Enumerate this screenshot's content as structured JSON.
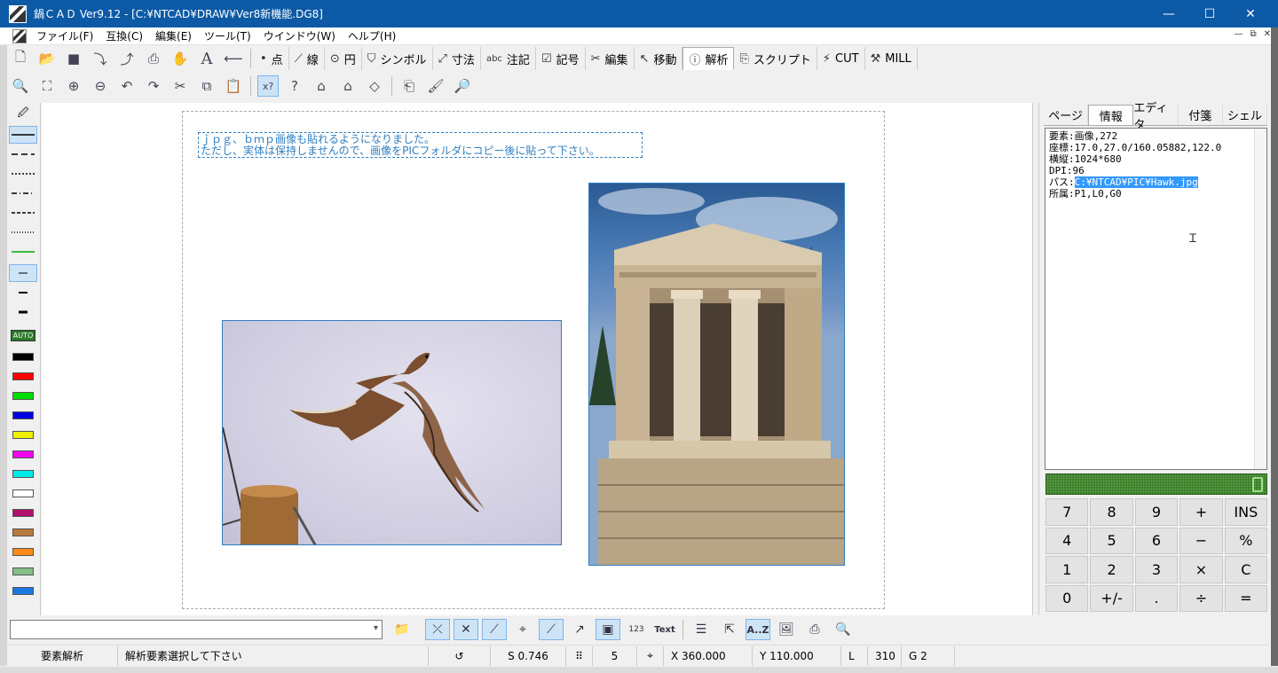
{
  "window": {
    "title": "鍋ＣＡＤ Ver9.12 - [C:¥NTCAD¥DRAW¥Ver8新機能.DG8]",
    "minimize": "—",
    "maximize": "☐",
    "close": "✕"
  },
  "menu": {
    "items": [
      "ファイル(F)",
      "互換(C)",
      "編集(E)",
      "ツール(T)",
      "ウインドウ(W)",
      "ヘルプ(H)"
    ],
    "mdi_buttons": [
      "—",
      "⧉",
      "✕"
    ]
  },
  "tabs": [
    {
      "label": "点",
      "icon": "point-icon"
    },
    {
      "label": "線",
      "icon": "line-icon"
    },
    {
      "label": "円",
      "icon": "circle-icon"
    },
    {
      "label": "シンボル",
      "icon": "symbol-icon"
    },
    {
      "label": "寸法",
      "icon": "dimension-icon"
    },
    {
      "label": "注記",
      "icon": "annotation-icon",
      "prefix": "abc"
    },
    {
      "label": "記号",
      "icon": "mark-icon"
    },
    {
      "label": "編集",
      "icon": "edit-icon"
    },
    {
      "label": "移動",
      "icon": "move-icon"
    },
    {
      "label": "解析",
      "icon": "info-icon",
      "active": true
    },
    {
      "label": "スクリプト",
      "icon": "script-icon"
    },
    {
      "label": "CUT",
      "icon": "cut-tool-icon"
    },
    {
      "label": "MILL",
      "icon": "mill-icon"
    }
  ],
  "canvas": {
    "note_line1": "ｊｐｇ、ｂｍｐ画像も貼れるようになりました。",
    "note_line2": "ただし、実体は保持しませんので、画像をPICフォルダにコピー後に貼って下さい。",
    "palette_auto": "AUTO",
    "palette_colors": [
      "#000000",
      "#ff0000",
      "#00e000",
      "#0000e0",
      "#f0f000",
      "#f000f0",
      "#00e8e8",
      "#ffffff",
      "#b0106a",
      "#b87a3a",
      "#ff8a1a",
      "#84c086",
      "#1a78e0"
    ],
    "line_color": "#2f7fc1"
  },
  "right_panel": {
    "tabs": [
      "ページ",
      "情報",
      "エディタ",
      "付箋",
      "シェル"
    ],
    "active_tab": "情報",
    "info": {
      "line1": "要素:画像,272",
      "line2": "座標:17.0,27.0/160.05882,122.0",
      "line3": "横縦:1024*680",
      "line4": "DPI:96",
      "line5_label": "パス:",
      "line5_value": "C:¥NTCAD¥PIC¥Hawk.jpg",
      "line6": "所属:P1,L0,G0"
    },
    "calculator": {
      "keys": [
        "7",
        "8",
        "9",
        "+",
        "INS",
        "4",
        "5",
        "6",
        "−",
        "%",
        "1",
        "2",
        "3",
        "×",
        "C",
        "0",
        "+/-",
        ".",
        "÷",
        "="
      ]
    }
  },
  "bottom_toolbar": {
    "command_value": "",
    "text_button": "Text",
    "az_button": "A..Z",
    "num_button": "123"
  },
  "status": {
    "mode": "要素解析",
    "message": "解析要素選択して下さい",
    "scale": "S 0.746",
    "grid": "5",
    "x": "X 360.000",
    "y": "Y 110.000",
    "layer": "L",
    "layer_value": "310",
    "group": "G 2"
  },
  "colors": {
    "titlebar": "#0c5aa6",
    "accent_selected": "#cde4f7",
    "highlight": "#3399ff"
  }
}
